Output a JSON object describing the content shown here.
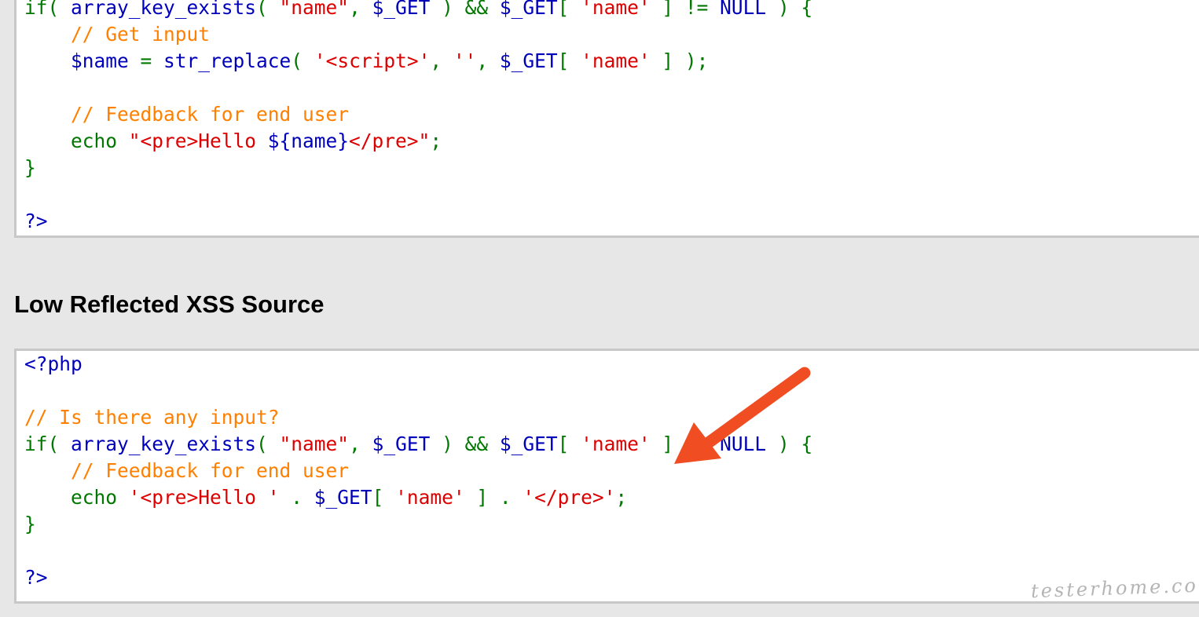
{
  "colors": {
    "string": "#dd0000",
    "keyword": "#007700",
    "comment": "#ff8000",
    "default": "#0000bb",
    "arrow": "#f04d23"
  },
  "top_code": {
    "lines": [
      [
        {
          "t": "if( ",
          "c": "kw"
        },
        {
          "t": "array_key_exists",
          "c": "def"
        },
        {
          "t": "( ",
          "c": "kw"
        },
        {
          "t": "\"name\"",
          "c": "str"
        },
        {
          "t": ", ",
          "c": "kw"
        },
        {
          "t": "$_GET ",
          "c": "def"
        },
        {
          "t": ") && ",
          "c": "kw"
        },
        {
          "t": "$_GET",
          "c": "def"
        },
        {
          "t": "[ ",
          "c": "kw"
        },
        {
          "t": "'name' ",
          "c": "str"
        },
        {
          "t": "] != ",
          "c": "kw"
        },
        {
          "t": "NULL ",
          "c": "def"
        },
        {
          "t": ") {",
          "c": "kw"
        }
      ],
      [
        {
          "t": "    // Get input",
          "c": "cmt"
        }
      ],
      [
        {
          "t": "    $name ",
          "c": "def"
        },
        {
          "t": "= ",
          "c": "kw"
        },
        {
          "t": "str_replace",
          "c": "def"
        },
        {
          "t": "( ",
          "c": "kw"
        },
        {
          "t": "'<script>'",
          "c": "str"
        },
        {
          "t": ", ",
          "c": "kw"
        },
        {
          "t": "''",
          "c": "str"
        },
        {
          "t": ", ",
          "c": "kw"
        },
        {
          "t": "$_GET",
          "c": "def"
        },
        {
          "t": "[ ",
          "c": "kw"
        },
        {
          "t": "'name' ",
          "c": "str"
        },
        {
          "t": "] );",
          "c": "kw"
        }
      ],
      [],
      [
        {
          "t": "    // Feedback for end user",
          "c": "cmt"
        }
      ],
      [
        {
          "t": "    echo ",
          "c": "kw"
        },
        {
          "t": "\"<pre>Hello ",
          "c": "str"
        },
        {
          "t": "${name}",
          "c": "def"
        },
        {
          "t": "</pre>\"",
          "c": "str"
        },
        {
          "t": ";",
          "c": "kw"
        }
      ],
      [
        {
          "t": "}",
          "c": "kw"
        }
      ],
      [],
      [
        {
          "t": "?>",
          "c": "def"
        }
      ]
    ]
  },
  "low_section": {
    "title": "Low Reflected XSS Source"
  },
  "low_code": {
    "lines": [
      [
        {
          "t": "<?php",
          "c": "def"
        }
      ],
      [],
      [
        {
          "t": "// Is there any input?",
          "c": "cmt"
        }
      ],
      [
        {
          "t": "if( ",
          "c": "kw"
        },
        {
          "t": "array_key_exists",
          "c": "def"
        },
        {
          "t": "( ",
          "c": "kw"
        },
        {
          "t": "\"name\"",
          "c": "str"
        },
        {
          "t": ", ",
          "c": "kw"
        },
        {
          "t": "$_GET ",
          "c": "def"
        },
        {
          "t": ") && ",
          "c": "kw"
        },
        {
          "t": "$_GET",
          "c": "def"
        },
        {
          "t": "[ ",
          "c": "kw"
        },
        {
          "t": "'name' ",
          "c": "str"
        },
        {
          "t": "] != ",
          "c": "kw"
        },
        {
          "t": "NULL ",
          "c": "def"
        },
        {
          "t": ") {",
          "c": "kw"
        }
      ],
      [
        {
          "t": "    // Feedback for end user",
          "c": "cmt"
        }
      ],
      [
        {
          "t": "    echo ",
          "c": "kw"
        },
        {
          "t": "'<pre>Hello ' ",
          "c": "str"
        },
        {
          "t": ". ",
          "c": "kw"
        },
        {
          "t": "$_GET",
          "c": "def"
        },
        {
          "t": "[ ",
          "c": "kw"
        },
        {
          "t": "'name' ",
          "c": "str"
        },
        {
          "t": "] . ",
          "c": "kw"
        },
        {
          "t": "'</pre>'",
          "c": "str"
        },
        {
          "t": ";",
          "c": "kw"
        }
      ],
      [
        {
          "t": "}",
          "c": "kw"
        }
      ],
      [],
      [
        {
          "t": "?>",
          "c": "def"
        }
      ]
    ]
  },
  "watermark": {
    "text": "testerhome.com"
  },
  "icons": {
    "annotation_arrow": "arrow-icon"
  }
}
